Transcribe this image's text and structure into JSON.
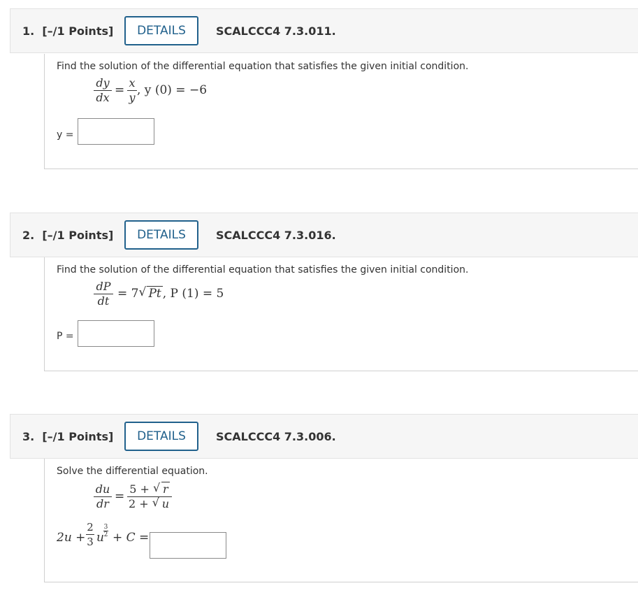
{
  "questions": [
    {
      "number_label": "1.",
      "points_label": "[–/1 Points]",
      "details_label": "DETAILS",
      "code": "SCALCCC4 7.3.011.",
      "prompt": "Find the solution of the differential equation that satisfies the given initial condition.",
      "eq_num": "dy",
      "eq_den": "dx",
      "eq_rhs_num": "x",
      "eq_rhs_den": "y",
      "eq_tail": ", y (0) = −6",
      "answer_label": "y =",
      "answer_value": ""
    },
    {
      "number_label": "2.",
      "points_label": "[–/1 Points]",
      "details_label": "DETAILS",
      "code": "SCALCCC4 7.3.016.",
      "prompt": "Find the solution of the differential equation that satisfies the given initial condition.",
      "eq_num": "dP",
      "eq_den": "dt",
      "eq_rhs_coef": "= 7",
      "eq_rhs_radicand": "Pt",
      "eq_tail": ", P (1) = 5",
      "answer_label": "P =",
      "answer_value": ""
    },
    {
      "number_label": "3.",
      "points_label": "[–/1 Points]",
      "details_label": "DETAILS",
      "code": "SCALCCC4 7.3.006.",
      "prompt": "Solve the differential equation.",
      "eq_num": "du",
      "eq_den": "dr",
      "eq_rhs_num_a": "5 +",
      "eq_rhs_num_rad": "r",
      "eq_rhs_den_a": "2 +",
      "eq_rhs_den_rad": "u",
      "answer_prefix_a": "2u +",
      "answer_frac_num": "2",
      "answer_frac_den": "3",
      "answer_prefix_u": "u",
      "answer_exp_num": "3",
      "answer_exp_den": "2",
      "answer_prefix_b": "+ C =",
      "answer_value": ""
    }
  ]
}
